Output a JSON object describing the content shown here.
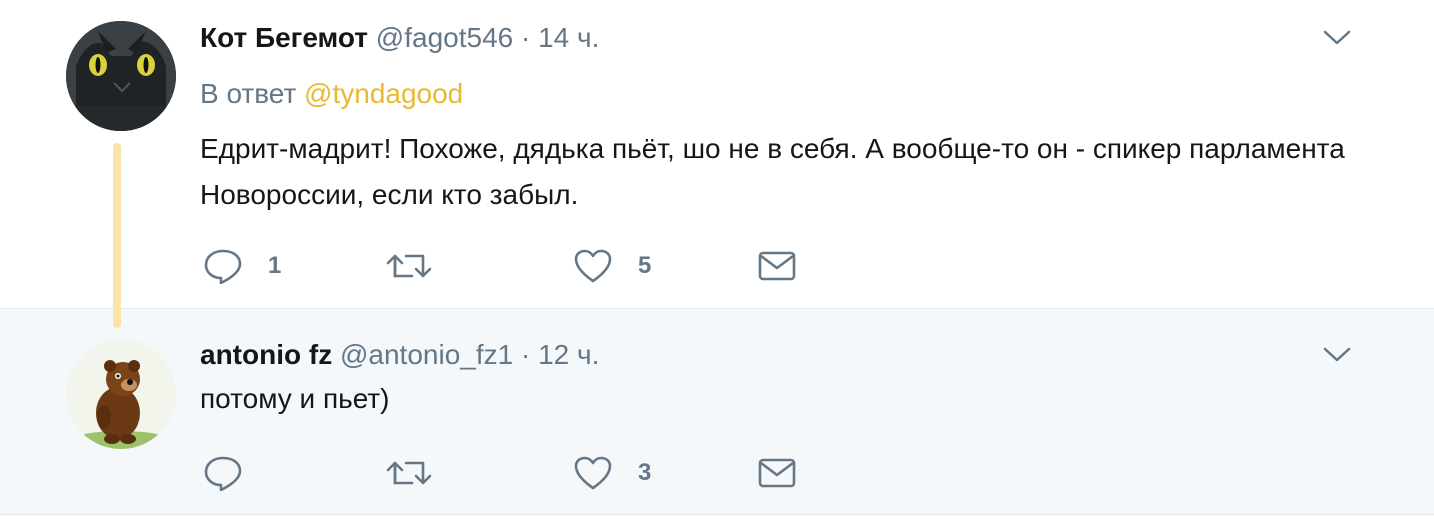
{
  "tweets": [
    {
      "name": "Кот Бегемот",
      "handle": "@fagot546",
      "separator": "·",
      "time": "14 ч.",
      "reply_prefix": "В ответ",
      "reply_mention": "@tyndagood",
      "text": "Едрит-мадрит! Похоже, дядька пьёт, шо не в себя. А вообще-то он - спикер парламента Новороссии, если кто забыл.",
      "reply_count": "1",
      "retweet_count": "",
      "like_count": "5",
      "avatar_icon": "black-cat-avatar"
    },
    {
      "name": "antonio fz",
      "handle": "@antonio_fz1",
      "separator": "·",
      "time": "12 ч.",
      "text": "потому и пьет)",
      "reply_count": "",
      "retweet_count": "",
      "like_count": "3",
      "avatar_icon": "winnie-the-pooh-avatar"
    }
  ],
  "icons": {
    "reply": "speech-bubble-icon",
    "retweet": "retweet-arrows-icon",
    "like": "heart-icon",
    "dm": "envelope-icon",
    "caret": "chevron-down-icon"
  },
  "colors": {
    "secondary_text": "#657786",
    "mention": "#e8b931",
    "thread_line": "#fbe5a6",
    "reply_background": "#f5f8fa"
  }
}
